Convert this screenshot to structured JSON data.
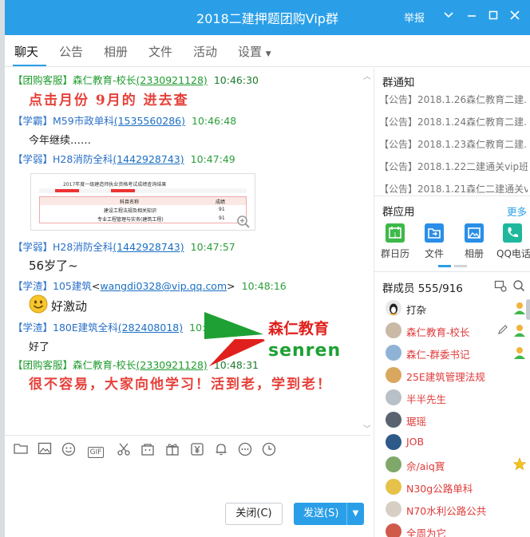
{
  "window": {
    "title": "2018二建押题团购Vip群",
    "report": "举报"
  },
  "tabs": [
    "聊天",
    "公告",
    "相册",
    "文件",
    "活动",
    "设置"
  ],
  "messages": [
    {
      "role": "【团购客服】",
      "nick": "森仁教育-校长",
      "uid": "(2330921128)",
      "time": "10:46:30",
      "type": "support"
    },
    {
      "role": "【学霸】",
      "nick": "M59市政单科",
      "uid": "(1535560286)",
      "time": "10:46:48",
      "type": "member"
    },
    {
      "role": "【学弱】",
      "nick": "H28消防全科",
      "uid": "(1442928743)",
      "time": "10:47:49",
      "type": "member"
    },
    {
      "role": "【学弱】",
      "nick": "H28消防全科",
      "uid": "(1442928743)",
      "time": "10:47:57",
      "type": "member"
    },
    {
      "role": "【学渣】",
      "nick": "105建筑",
      "email": "wangdi0328@vip.qq.com",
      "time": "10:48:16",
      "type": "member"
    },
    {
      "role": "【学渣】",
      "nick": "180E建筑全科",
      "uid": "(282408018)",
      "time": "10:48:25",
      "type": "member"
    },
    {
      "role": "【团购客服】",
      "nick": "森仁教育-校长",
      "uid": "(2330921128)",
      "time": "10:48:31",
      "type": "support"
    }
  ],
  "msg_texts": {
    "m1": "点击月份 9月的 进去查",
    "m2": "今年继续……",
    "m4": "56岁了~",
    "m5": "好激动",
    "m6": "好了",
    "m7": "很不容易，大家向他学习！活到老，学到老！"
  },
  "thumbnail": {
    "title": "2017年度一级建造师执业资格考试成绩查询结果",
    "col_subject": "科目名称",
    "col_score": "成绩",
    "rows": [
      {
        "subject": "建设工程法规及相关知识",
        "score": "91"
      },
      {
        "subject": "专业工程管理与实务(建筑工程)",
        "score": "91"
      }
    ]
  },
  "logo": {
    "cn": "森仁教育",
    "en": "senren"
  },
  "toolbar": {
    "icons": [
      "folder-icon",
      "image-icon",
      "emoji-icon",
      "gif-icon",
      "scissors-icon",
      "shop-icon",
      "gift-icon",
      "yen-icon",
      "bell-icon",
      "more-icon",
      "clock-icon"
    ],
    "gif_label": "GIF"
  },
  "buttons": {
    "close": "关闭(C)",
    "send": "发送(S)"
  },
  "notices": {
    "title": "群通知",
    "items": [
      "【公告】2018.1.26森仁教育二建...",
      "【公告】2018.1.24森仁教育二建...",
      "【公告】2018.1.23森仁教育二建...",
      "【公告】2018.1.22二建通关vip班...",
      "【公告】2018.1.21森仁二建通关vi..."
    ]
  },
  "apps": {
    "title": "群应用",
    "more": "更多",
    "items": [
      "群日历",
      "文件",
      "相册",
      "QQ电话"
    ]
  },
  "members": {
    "title": "群成员",
    "count": "555/916",
    "items": [
      {
        "name": "打杂",
        "color": "#222"
      },
      {
        "name": "森仁教育-校长",
        "color": "#e03a3a"
      },
      {
        "name": "森仁-群委书记",
        "color": "#e03a3a"
      },
      {
        "name": "25E建筑管理法规",
        "color": "#e03a3a"
      },
      {
        "name": "半半先生",
        "color": "#e03a3a"
      },
      {
        "name": "琚瑶",
        "color": "#e03a3a"
      },
      {
        "name": "JOB",
        "color": "#e03a3a"
      },
      {
        "name": "佘/aiq寳",
        "color": "#e03a3a"
      },
      {
        "name": "N30g公路单科",
        "color": "#e03a3a"
      },
      {
        "name": "N70水利公路公共",
        "color": "#e03a3a"
      },
      {
        "name": "全周为它",
        "color": "#e03a3a"
      }
    ]
  },
  "colors": {
    "accent": "#2a9fe8",
    "support_green": "#1e9b2e",
    "admin_red": "#e03a3a"
  }
}
